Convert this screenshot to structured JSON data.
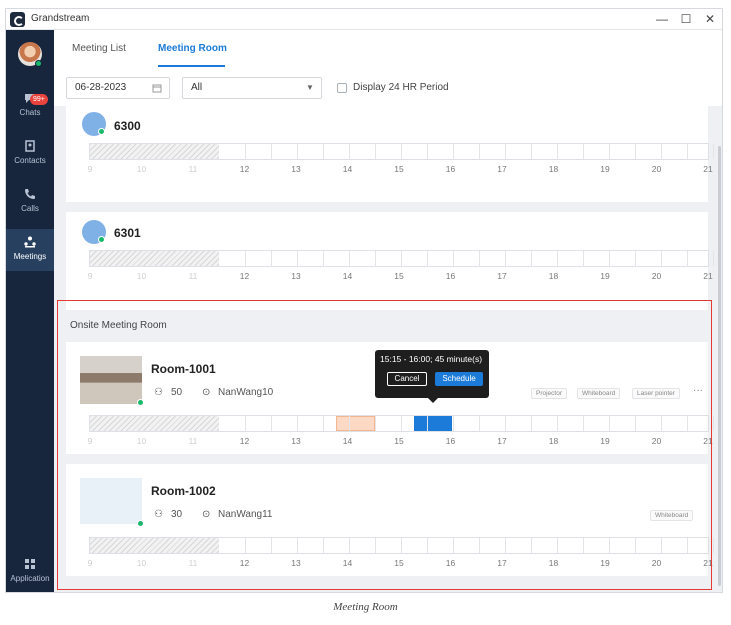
{
  "app": {
    "title": "Grandstream",
    "window_controls": [
      "—",
      "☐",
      "✕"
    ]
  },
  "sidebar": {
    "badge": "99+",
    "items": [
      {
        "label": "Chats",
        "icon": "chat-icon"
      },
      {
        "label": "Contacts",
        "icon": "contacts-icon"
      },
      {
        "label": "Calls",
        "icon": "phone-icon"
      },
      {
        "label": "Meetings",
        "icon": "meetings-icon"
      },
      {
        "label": "Application",
        "icon": "apps-icon"
      }
    ]
  },
  "tabs": [
    {
      "label": "Meeting List"
    },
    {
      "label": "Meeting Room"
    }
  ],
  "filters": {
    "date": "06-28-2023",
    "type": "All",
    "display24": "Display 24 HR Period"
  },
  "hours": [
    "9",
    "10",
    "11",
    "12",
    "13",
    "14",
    "15",
    "16",
    "17",
    "18",
    "19",
    "20",
    "21"
  ],
  "rooms": [
    {
      "name": "6300"
    },
    {
      "name": "6301"
    }
  ],
  "onsite": {
    "section_title": "Onsite Meeting Room",
    "rooms": [
      {
        "name": "Room-1001",
        "capacity": "50",
        "location": "NanWang10",
        "tags": [
          "Projector",
          "Whiteboard",
          "Laser pointer"
        ],
        "more": "···"
      },
      {
        "name": "Room-1002",
        "capacity": "30",
        "location": "NanWang11",
        "tags": [
          "Whiteboard"
        ]
      }
    ]
  },
  "tooltip": {
    "text": "15:15 - 16:00; 45 minute(s)",
    "cancel": "Cancel",
    "schedule": "Schedule"
  },
  "caption": "Meeting Room"
}
